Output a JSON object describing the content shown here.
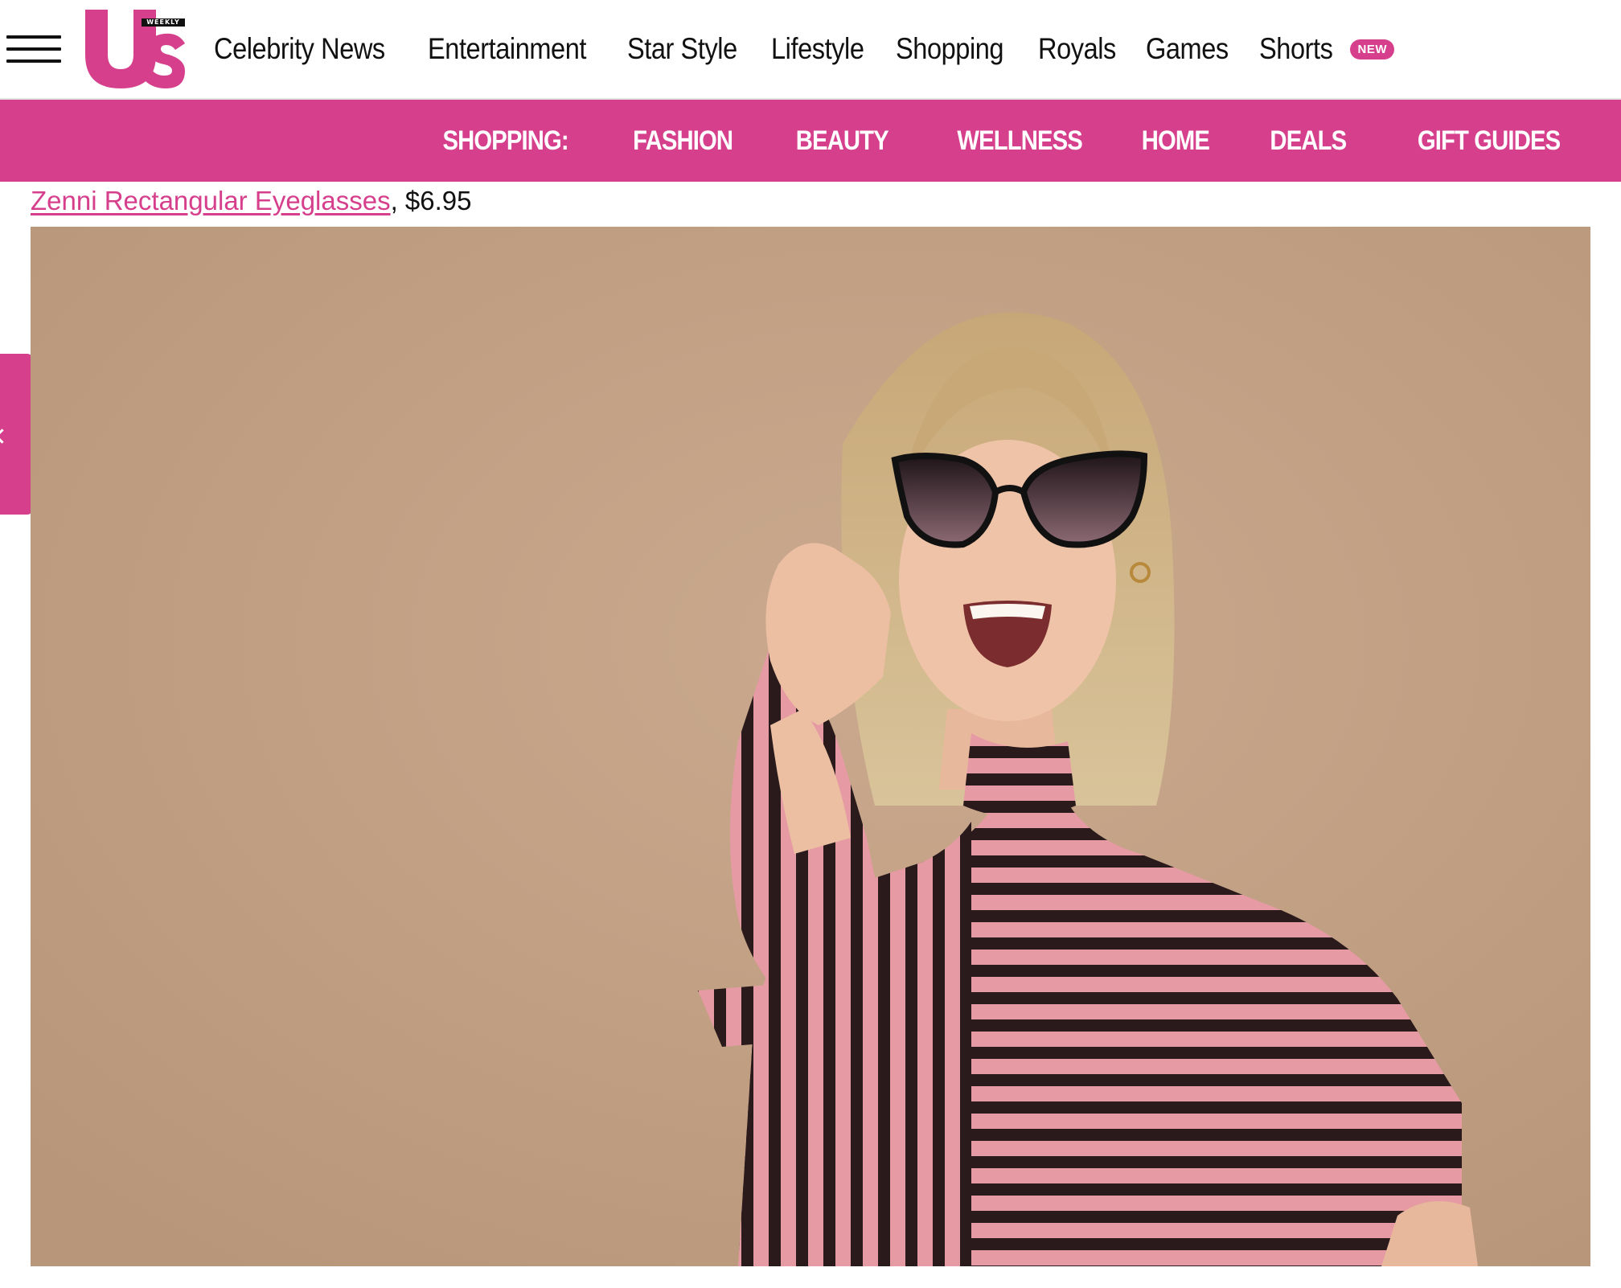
{
  "header": {
    "logo_text": "Us",
    "logo_tag": "WEEKLY",
    "nav": [
      {
        "label": "Celebrity News"
      },
      {
        "label": "Entertainment"
      },
      {
        "label": "Star Style"
      },
      {
        "label": "Lifestyle"
      },
      {
        "label": "Shopping"
      },
      {
        "label": "Royals"
      },
      {
        "label": "Games"
      },
      {
        "label": "Shorts"
      }
    ],
    "new_badge": "NEW"
  },
  "subnav": {
    "label": "SHOPPING:",
    "items": [
      {
        "label": "FASHION"
      },
      {
        "label": "BEAUTY"
      },
      {
        "label": "WELLNESS"
      },
      {
        "label": "HOME"
      },
      {
        "label": "DEALS"
      },
      {
        "label": "GIFT GUIDES"
      }
    ]
  },
  "caption": {
    "link_text": "Zenni Rectangular Eyeglasses",
    "price_text": ", $6.95"
  },
  "colors": {
    "brand_pink": "#d63f8c",
    "photo_background": "#c6a68c"
  },
  "icons": {
    "menu": "hamburger-menu-icon",
    "side_tab": "chevron-left-icon"
  }
}
